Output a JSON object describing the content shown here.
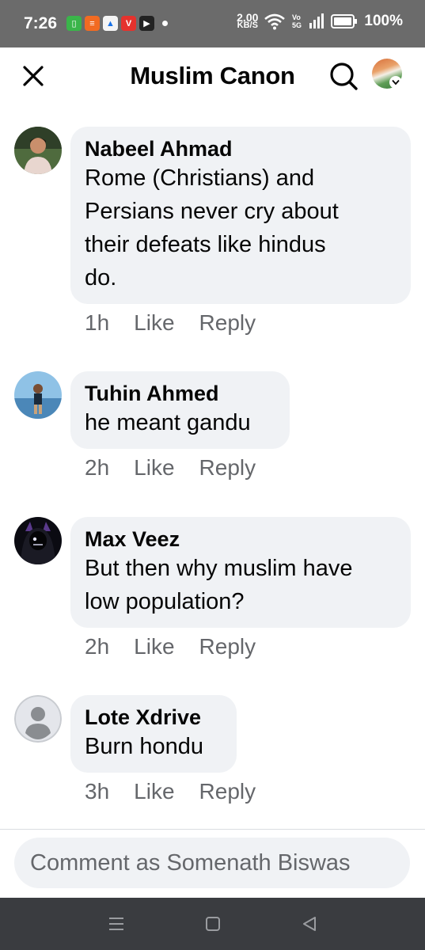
{
  "status_bar": {
    "time": "7:26",
    "net_speed_value": "2.00",
    "net_speed_unit": "KB/S",
    "battery": "100%",
    "apps": [
      {
        "icon": "phone-app-icon",
        "color": "#3ab54a",
        "glyph": "▯"
      },
      {
        "icon": "news-app-icon",
        "color": "#f26b22",
        "glyph": "≡"
      },
      {
        "icon": "drive-app-icon",
        "color": "#f4f4f4",
        "glyph": "▲"
      },
      {
        "icon": "v-app-icon",
        "color": "#e5322d",
        "glyph": "V"
      },
      {
        "icon": "youtube-app-icon",
        "color": "#222222",
        "glyph": "▶"
      }
    ]
  },
  "header": {
    "title": "Muslim Canon"
  },
  "comments": [
    {
      "author": "Nabeel Ahmad",
      "lines": [
        "Rome (Christians) and",
        "Persians never cry about",
        "their defeats like hindus",
        "do."
      ],
      "time": "1h",
      "like": "Like",
      "reply": "Reply"
    },
    {
      "author": "Tuhin Ahmed",
      "lines": [
        "he meant gandu"
      ],
      "time": "2h",
      "like": "Like",
      "reply": "Reply"
    },
    {
      "author": "Max Veez",
      "lines": [
        "But then why muslim have",
        "low population?"
      ],
      "time": "2h",
      "like": "Like",
      "reply": "Reply"
    },
    {
      "author": "Lote Xdrive",
      "lines": [
        "Burn hondu"
      ],
      "time": "3h",
      "like": "Like",
      "reply": "Reply"
    }
  ],
  "composer": {
    "placeholder": "Comment as Somenath Biswas"
  },
  "colors": {
    "bubble": "#f0f2f5",
    "meta_text": "#65676b",
    "status_bar": "#6b6b6b",
    "nav_bar": "#3a3c40"
  }
}
